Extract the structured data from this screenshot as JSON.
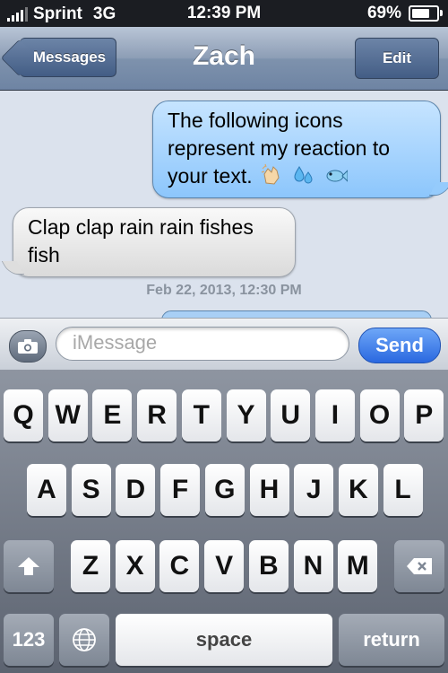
{
  "status_bar": {
    "carrier": "Sprint",
    "network": "3G",
    "time": "12:39 PM",
    "battery": "69%",
    "battery_level": 0.69
  },
  "nav": {
    "back_label": "Messages",
    "title": "Zach",
    "edit_label": "Edit"
  },
  "messages": [
    {
      "direction": "outgoing",
      "text": "The following icons represent my reaction to your text.",
      "emoji": [
        "clapping-hands-icon",
        "sweat-droplets-icon",
        "fish-icon"
      ]
    },
    {
      "direction": "incoming",
      "text": "Clap clap rain rain fishes fish"
    }
  ],
  "timestamp": "Feb 22, 2013, 12:30 PM",
  "compose": {
    "placeholder": "iMessage",
    "send_label": "Send"
  },
  "keyboard": {
    "row1": [
      "Q",
      "W",
      "E",
      "R",
      "T",
      "Y",
      "U",
      "I",
      "O",
      "P"
    ],
    "row2": [
      "A",
      "S",
      "D",
      "F",
      "G",
      "H",
      "J",
      "K",
      "L"
    ],
    "row3": [
      "Z",
      "X",
      "C",
      "V",
      "B",
      "N",
      "M"
    ],
    "numbers_label": "123",
    "space_label": "space",
    "return_label": "return"
  },
  "colors": {
    "send": "#2a68e0",
    "outgoing_bubble": "#8cc6fc",
    "nav": "#7e92ad"
  }
}
